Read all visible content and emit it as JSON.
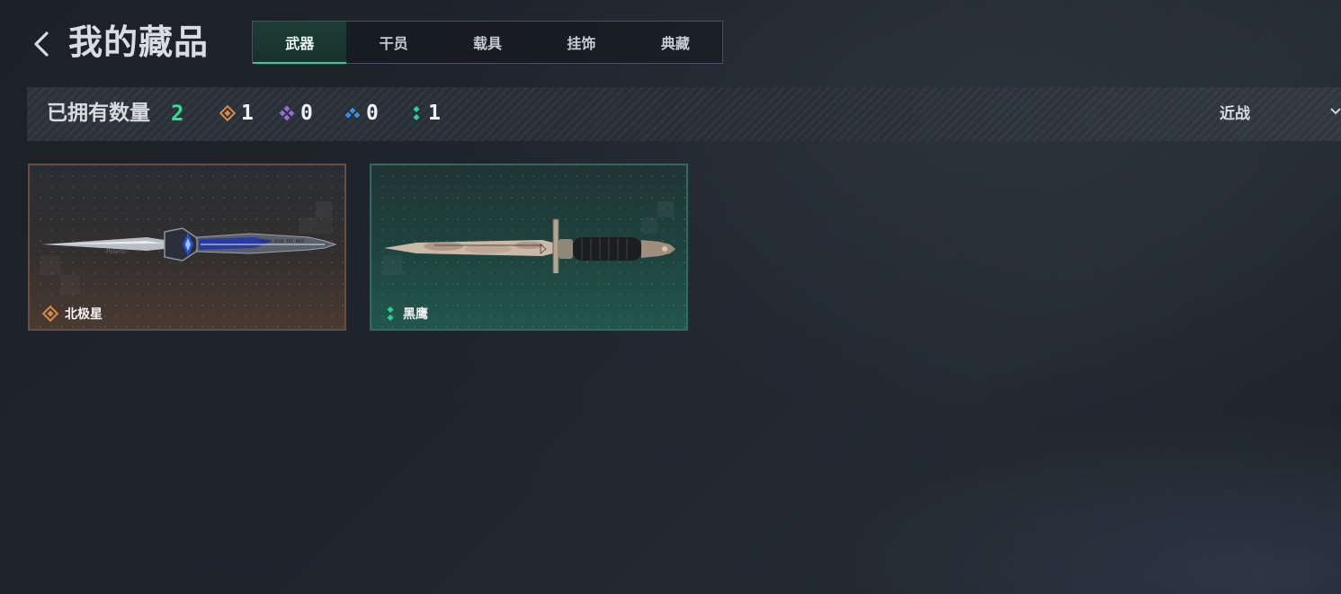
{
  "header": {
    "title": "我的藏品",
    "tabs": [
      {
        "label": "武器",
        "active": true
      },
      {
        "label": "干员",
        "active": false
      },
      {
        "label": "载具",
        "active": false
      },
      {
        "label": "挂饰",
        "active": false
      },
      {
        "label": "典藏",
        "active": false
      }
    ]
  },
  "stats": {
    "owned_label": "已拥有数量",
    "owned_count": "2",
    "rarity_counts": [
      {
        "icon": "gold-diamond-icon",
        "color": "#d98a4a",
        "count": "1"
      },
      {
        "icon": "purple-diamond-icon",
        "color": "#9b6ce0",
        "count": "0"
      },
      {
        "icon": "blue-diamond-icon",
        "color": "#3f8be0",
        "count": "0"
      },
      {
        "icon": "green-diamond-icon",
        "color": "#2fcf9a",
        "count": "1"
      }
    ],
    "filter_label": "近战"
  },
  "items": [
    {
      "name": "北极星",
      "rarity": "gold",
      "rarity_color": "#d98a4a",
      "icon": "gold-diamond-icon"
    },
    {
      "name": "黑鹰",
      "rarity": "green",
      "rarity_color": "#2fcf9a",
      "icon": "green-diamond-icon"
    }
  ],
  "colors": {
    "accent_green": "#2ee28f",
    "tab_active_underline": "#2fcf9a"
  }
}
